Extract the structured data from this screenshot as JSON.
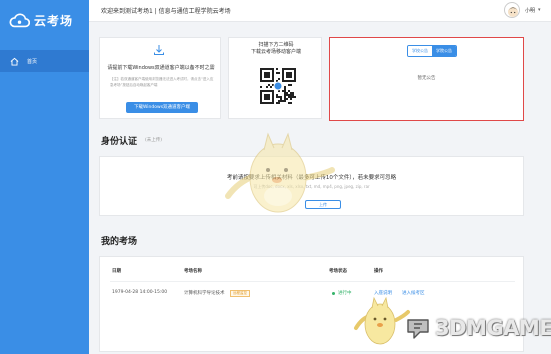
{
  "app": {
    "name": "云考场"
  },
  "sidebar": {
    "items": [
      {
        "label": "首页",
        "icon": "home-icon"
      }
    ]
  },
  "header": {
    "welcome": "欢迎来到测试考场1 | 信息与通信工程学院云考场",
    "username": "小明"
  },
  "download_card": {
    "title": "请提前下载Windows双通道客户端以备不时之需",
    "description": "【注】若双通道客户端使用浏览器无法进入考试时，请点击“进入应急考场”按钮后自动唤起客户端",
    "button_label": "下载Windows双通道客户端"
  },
  "qr_card": {
    "line1": "扫描下方二维码",
    "line2": "下载云考场移动客户端"
  },
  "notice_card": {
    "tabs": [
      "学校公告",
      "学院公告"
    ],
    "active_tab": 1,
    "empty_text": "暂无公告"
  },
  "identity": {
    "title": "身份认证",
    "subtitle": "(未上传)",
    "hint": "考前请按要求上传相关材料（最多可上传10个文件），若未要求可忽略",
    "file_types": "可上传doc, docx, xls, xlsx, txt, md, mp4, png, jpeg, zip, rar",
    "upload_label": "上传"
  },
  "exams": {
    "title": "我的考场",
    "headers": [
      "日期",
      "考场名称",
      "考场状态",
      "操作"
    ],
    "rows": [
      {
        "date": "1979-04-28 14:00-15:00",
        "name": "计算机科学导论技术",
        "badge": "远程监控",
        "status": "进行中",
        "action1": "入座说明",
        "action2": "进入候考区"
      }
    ]
  },
  "watermark": {
    "text": "3DMGAME"
  },
  "colors": {
    "primary": "#3a8ee6",
    "sidebar_active": "#2f7ad1",
    "highlight_border": "#e04848",
    "status_ok": "#35b36a"
  }
}
